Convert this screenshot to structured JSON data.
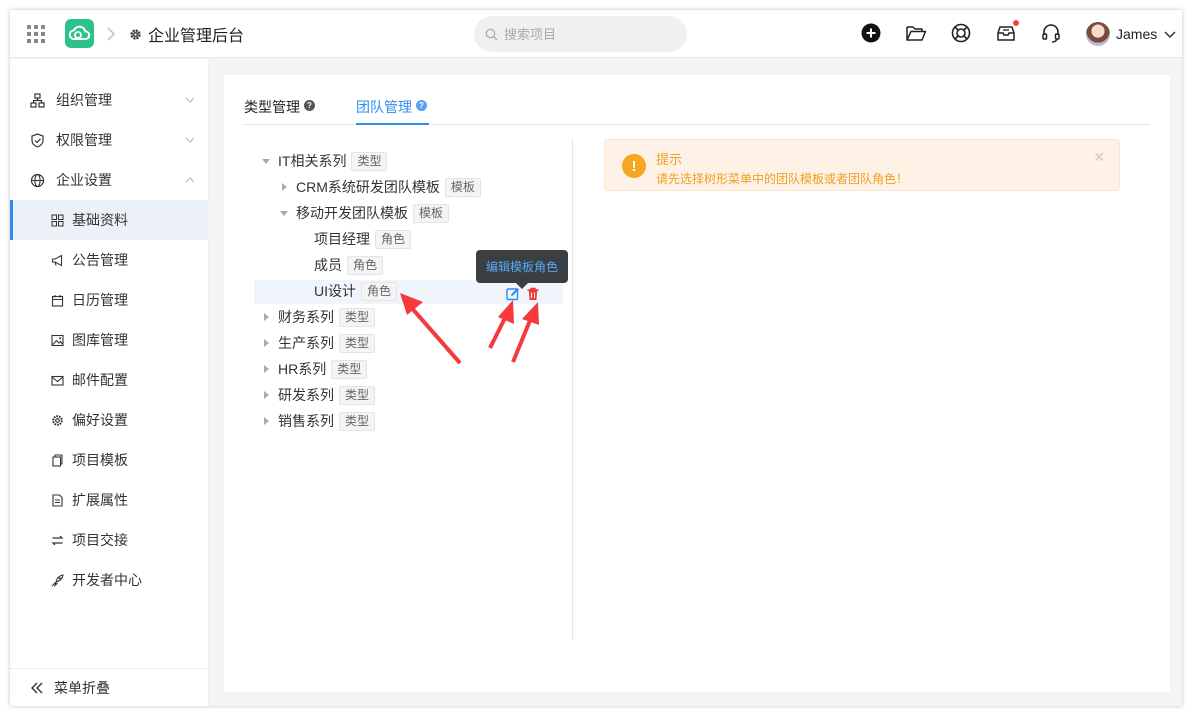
{
  "header": {
    "title": "企业管理后台",
    "search_placeholder": "搜索项目",
    "user_name": "James",
    "notification_dot_color": "#f5443b",
    "icons": [
      "apps-grid-icon",
      "cloud-logo-icon",
      "gear-icon",
      "search-icon",
      "add-circle-icon",
      "folder-open-icon",
      "lifebuoy-icon",
      "inbox-icon",
      "headset-icon",
      "chevron-down-icon"
    ]
  },
  "sidebar": {
    "groups": [
      {
        "label": "组织管理",
        "icon": "org-chart-icon"
      },
      {
        "label": "权限管理",
        "icon": "shield-icon"
      },
      {
        "label": "企业设置",
        "icon": "globe-icon"
      }
    ],
    "items": [
      {
        "label": "基础资料",
        "icon": "grid-icon"
      },
      {
        "label": "公告管理",
        "icon": "megaphone-icon"
      },
      {
        "label": "日历管理",
        "icon": "calendar-icon"
      },
      {
        "label": "图库管理",
        "icon": "image-icon"
      },
      {
        "label": "邮件配置",
        "icon": "mail-icon"
      },
      {
        "label": "偏好设置",
        "icon": "cog-icon"
      },
      {
        "label": "项目模板",
        "icon": "copy-icon"
      },
      {
        "label": "扩展属性",
        "icon": "document-icon"
      },
      {
        "label": "项目交接",
        "icon": "swap-icon"
      },
      {
        "label": "开发者中心",
        "icon": "rocket-icon"
      }
    ],
    "collapse_label": "菜单折叠",
    "accent_color": "#2d8cf0"
  },
  "tabs": [
    {
      "label": "类型管理"
    },
    {
      "label": "团队管理"
    }
  ],
  "tree": {
    "it": {
      "label": "IT相关系列",
      "tag": "类型"
    },
    "crm": {
      "label": "CRM系统研发团队模板",
      "tag": "模板"
    },
    "mobile": {
      "label": "移动开发团队模板",
      "tag": "模板"
    },
    "pm": {
      "label": "项目经理",
      "tag": "角色"
    },
    "member": {
      "label": "成员",
      "tag": "角色"
    },
    "ui": {
      "label": "UI设计",
      "tag": "角色"
    },
    "finance": {
      "label": "财务系列",
      "tag": "类型"
    },
    "production": {
      "label": "生产系列",
      "tag": "类型"
    },
    "hr": {
      "label": "HR系列",
      "tag": "类型"
    },
    "rd": {
      "label": "研发系列",
      "tag": "类型"
    },
    "sales": {
      "label": "销售系列",
      "tag": "类型"
    }
  },
  "tooltip": "编辑模板角色",
  "alert": {
    "title": "提示",
    "message": "请先选择树形菜单中的团队模板或者团队角色！",
    "color": "#f0a020"
  }
}
